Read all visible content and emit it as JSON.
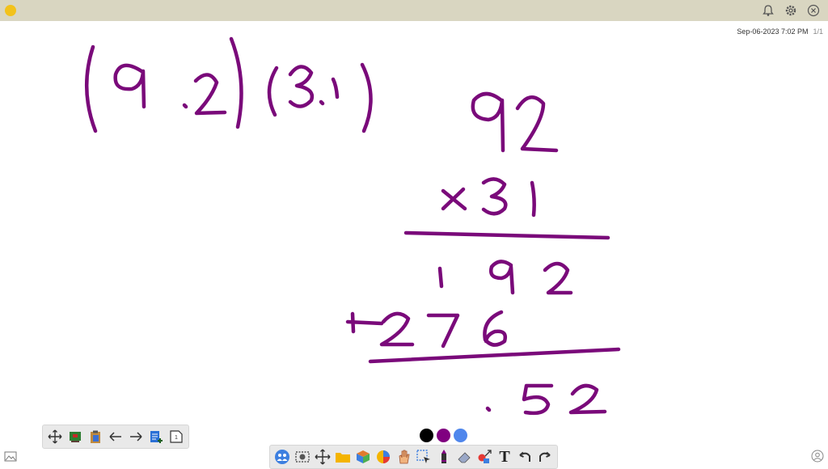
{
  "header": {
    "app_icon": "pencil-app-icon",
    "icons": [
      "bell-icon",
      "gear-icon",
      "close-icon"
    ]
  },
  "stamp": {
    "datetime": "Sep-06-2023 7:02 PM",
    "page": "1/1"
  },
  "colors": {
    "ink": "#7a0a7a",
    "swatches": [
      "#000000",
      "#800080",
      "#4f86ec"
    ]
  },
  "left_toolbar": {
    "icons": [
      "move-arrows-icon",
      "whiteboard-green-icon",
      "clipboard-icon",
      "arrow-left-icon",
      "arrow-right-icon",
      "add-page-icon",
      "page-number-icon"
    ],
    "page_label": "1"
  },
  "bottom_toolbar": {
    "icons": [
      "people-icon",
      "camera-icon",
      "move-arrows-icon",
      "folder-icon",
      "shapes-icon",
      "color-picker-icon",
      "hand-icon",
      "selection-icon",
      "marker-pen-icon",
      "eraser-icon",
      "shapes-arrow-icon",
      "text-tool-icon",
      "undo-icon",
      "redo-icon"
    ],
    "text_label": "T"
  }
}
